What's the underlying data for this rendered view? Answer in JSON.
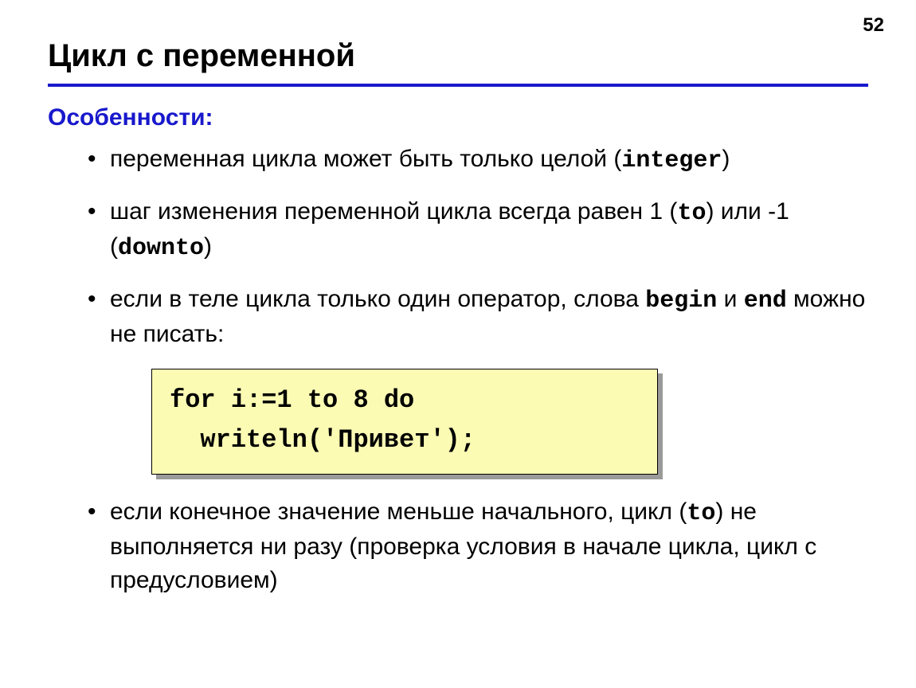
{
  "page_number": "52",
  "title": "Цикл с переменной",
  "subhead": "Особенности:",
  "bullets": {
    "b1": {
      "p1": "переменная цикла может быть только целой (",
      "kw": "integer",
      "p2": ")"
    },
    "b2": {
      "p1": "шаг изменения переменной цикла всегда равен 1 (",
      "kw1": "to",
      "p2": ") или -1 (",
      "kw2": "downto",
      "p3": ")"
    },
    "b3": {
      "p1": "если в теле цикла только один оператор, слова ",
      "kw1": "begin",
      "p2": " и ",
      "kw2": "end",
      "p3": " можно не писать:"
    },
    "b4": {
      "p1": "если конечное значение меньше начального, цикл (",
      "kw": "to",
      "p2": ") не выполняется ни разу (проверка условия в начале цикла, цикл с предусловием)"
    }
  },
  "code": "for i:=1 to 8 do\n  writeln('Привет');"
}
